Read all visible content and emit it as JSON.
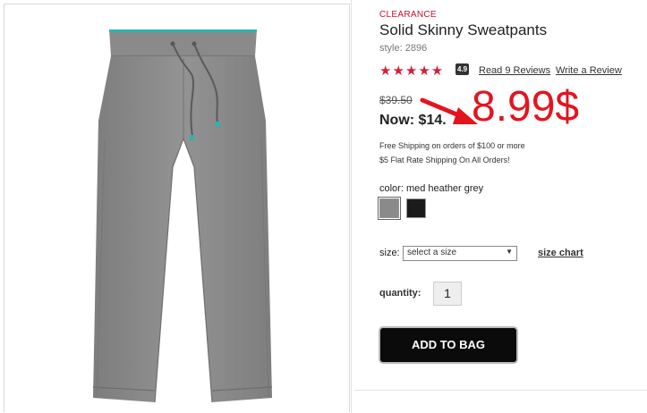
{
  "product": {
    "badge": "CLEARANCE",
    "title": "Solid Skinny Sweatpants",
    "style": "style: 2896",
    "rating_stars": "★★★★★",
    "rating_value": "4.9",
    "read_reviews": "Read 9 Reviews",
    "write_review": "Write a Review"
  },
  "price": {
    "old": "$39.50",
    "now": "Now: $14.",
    "annotation": "8.99$",
    "annotation_color": "#e4141e"
  },
  "shipping": {
    "line1": "Free Shipping on orders of $100 or more",
    "line2": "$5 Flat Rate Shipping On All Orders!"
  },
  "color": {
    "label": "color: med heather grey",
    "swatches": [
      {
        "name": "med heather grey",
        "hex": "#8a8a8a",
        "selected": true
      },
      {
        "name": "black",
        "hex": "#1b1b1d",
        "selected": false
      }
    ]
  },
  "size": {
    "label": "size:",
    "selected": "select a size",
    "chart_link": "size chart"
  },
  "quantity": {
    "label": "quantity:",
    "value": "1"
  },
  "cart": {
    "add_label": "ADD TO BAG"
  },
  "image": {
    "subject": "grey sweatpants",
    "fabric_color": "#8c8c8c",
    "waistband_accent": "#2bb3b0"
  }
}
